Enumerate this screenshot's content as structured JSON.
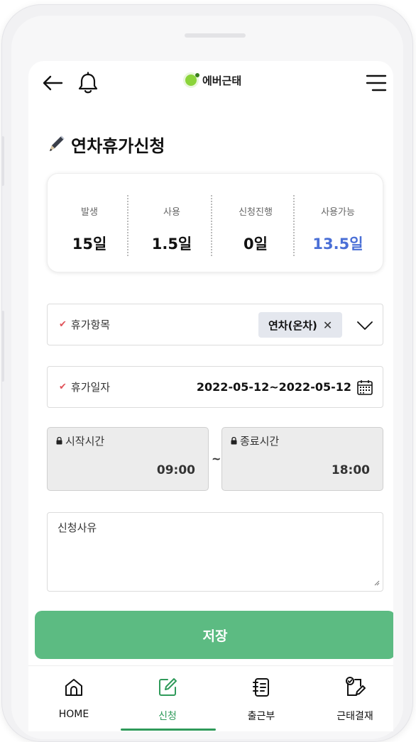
{
  "app": {
    "logo_text": "에버근태",
    "accent_color": "#5cbb82",
    "logo_color": "#8bd43a"
  },
  "header": {
    "back_icon": "back-arrow-icon",
    "notification_icon": "bell-icon",
    "menu_icon": "hamburger-menu-icon"
  },
  "page": {
    "title": "연차휴가신청",
    "title_icon": "pen-icon"
  },
  "summary": [
    {
      "label": "발생",
      "value": "15일"
    },
    {
      "label": "사용",
      "value": "1.5일"
    },
    {
      "label": "신청진행",
      "value": "0일"
    },
    {
      "label": "사용가능",
      "value": "13.5일",
      "color": "#4a6fd6"
    }
  ],
  "form": {
    "leave_type": {
      "label": "휴가항목",
      "selected": "연차(온차)"
    },
    "leave_date": {
      "label": "휴가일자",
      "value": "2022-05-12~2022-05-12"
    },
    "start_time": {
      "label": "시작시간",
      "value": "09:00"
    },
    "separator": "~",
    "end_time": {
      "label": "종료시간",
      "value": "18:00"
    },
    "reason": {
      "placeholder": "신청사유"
    }
  },
  "save_label": "저장",
  "bottom_nav": [
    {
      "label": "HOME",
      "icon": "home-icon",
      "active": false
    },
    {
      "label": "신청",
      "icon": "edit-icon",
      "active": true
    },
    {
      "label": "출근부",
      "icon": "notebook-icon",
      "active": false
    },
    {
      "label": "근태결재",
      "icon": "approval-icon",
      "active": false
    }
  ]
}
